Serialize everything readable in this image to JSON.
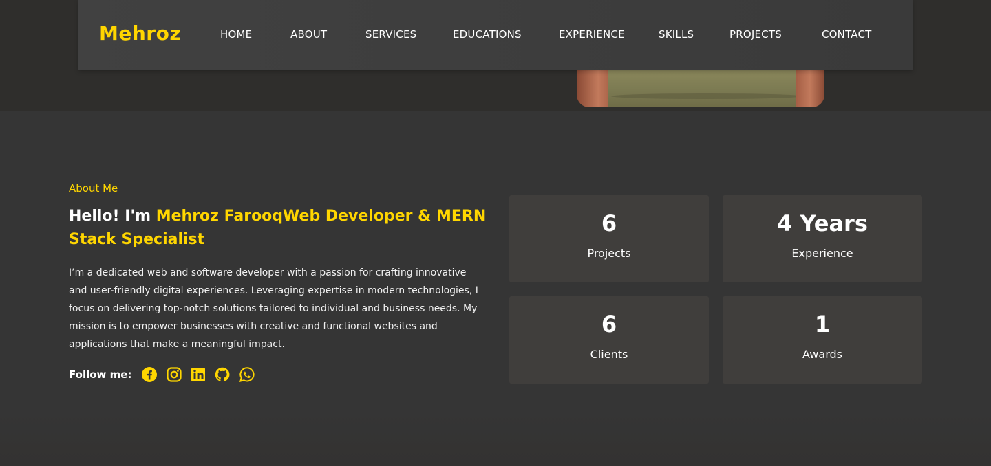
{
  "brand": {
    "logo": "Mehroz",
    "accent": "#ffd600"
  },
  "nav": {
    "items": [
      {
        "label": "HOME"
      },
      {
        "label": "ABOUT"
      },
      {
        "label": "SERVICES"
      },
      {
        "label": "EDUCATIONS"
      },
      {
        "label": "EXPERIENCE"
      },
      {
        "label": "SKILLS"
      },
      {
        "label": "PROJECTS"
      },
      {
        "label": "CONTACT"
      }
    ]
  },
  "about": {
    "eyebrow": "About Me",
    "greeting": "Hello! I'm ",
    "highlight": "Mehroz FarooqWeb Developer & MERN Stack Specialist",
    "description": "I’m a dedicated web and software developer with a passion for crafting innovative and user-friendly digital experiences. Leveraging expertise in modern technologies, I focus on delivering top-notch solutions tailored to individual and business needs. My mission is to empower businesses with creative and functional websites and applications that make a meaningful impact.",
    "follow_label": "Follow me:",
    "socials": [
      {
        "icon": "facebook-icon"
      },
      {
        "icon": "instagram-icon"
      },
      {
        "icon": "linkedin-icon"
      },
      {
        "icon": "github-icon"
      },
      {
        "icon": "whatsapp-icon"
      }
    ]
  },
  "stats": [
    {
      "value": "6",
      "label": "Projects"
    },
    {
      "value": "4 Years",
      "label": "Experience"
    },
    {
      "value": "6",
      "label": "Clients"
    },
    {
      "value": "1",
      "label": "Awards"
    }
  ]
}
